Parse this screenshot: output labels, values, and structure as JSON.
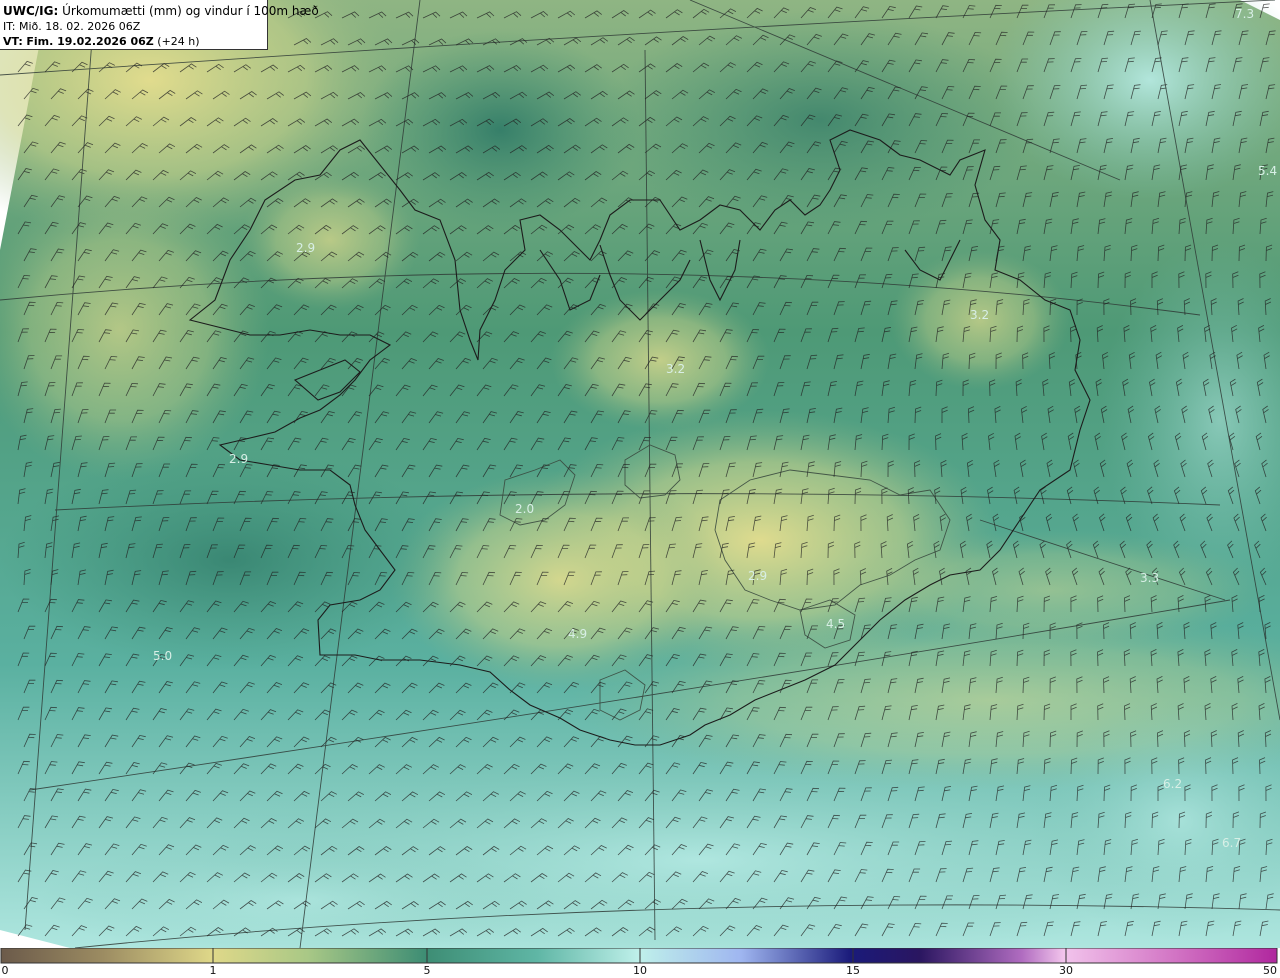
{
  "header": {
    "product": "UWC/IG:",
    "title": "Úrkomumætti (mm) og vindur í 100m hæð",
    "init_time": "IT: Mið. 18. 02. 2026 06Z",
    "valid_prefix": "VT:",
    "valid_time": "Fim. 19.02.2026 06Z",
    "valid_offset": "(+24 h)"
  },
  "map_values": [
    "7.3",
    "5.4",
    "2.9",
    "3.2",
    "3.2",
    "2.9",
    "2.0",
    "5.0",
    "2.9",
    "3.3",
    "6.2",
    "6.7",
    "4.9",
    "4.5"
  ],
  "colorbar": {
    "ticks": [
      "0",
      "1",
      "5",
      "10",
      "15",
      "30",
      "50"
    ],
    "colors": [
      "#6b5a4a",
      "#a4935e",
      "#dfd889",
      "#cfe08c",
      "#8ab77a",
      "#4e9a78",
      "#3b8c76",
      "#5fb6a5",
      "#9be0d8",
      "#c9f4f2",
      "#9fb6f0",
      "#4c4cc8",
      "#22136d",
      "#5a2d8a",
      "#d08ad8",
      "#f0b8e8",
      "#c85cb4",
      "#b0279e"
    ]
  },
  "colors": {
    "low": "#e1d989",
    "mid": "#3f8d73",
    "high": "#bff0ea",
    "coast": "#1c1c1c",
    "grid": "#2f3a36",
    "barb": "#222222"
  }
}
